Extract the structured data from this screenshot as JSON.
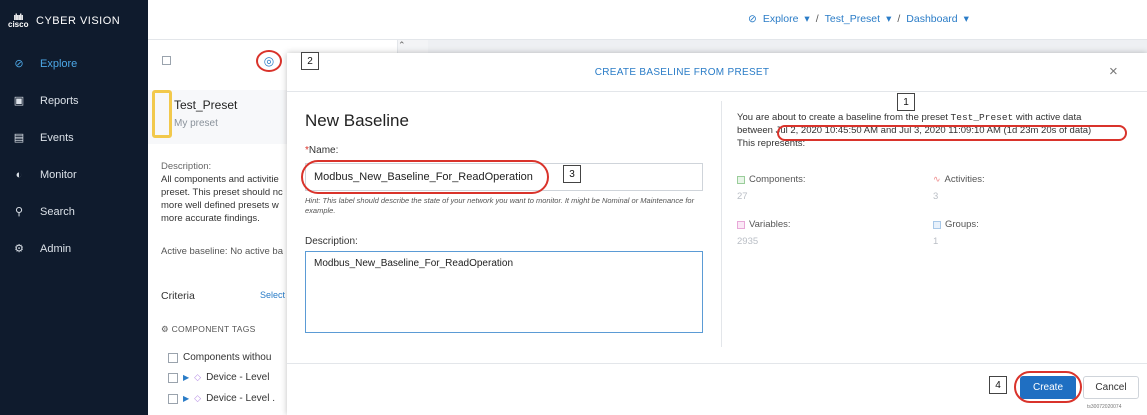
{
  "brand": {
    "logo": "cisco",
    "name": "CYBER VISION"
  },
  "nav": [
    {
      "label": "Explore",
      "icon": "compass-icon",
      "active": true
    },
    {
      "label": "Reports",
      "icon": "document-icon",
      "active": false
    },
    {
      "label": "Events",
      "icon": "calendar-icon",
      "active": false
    },
    {
      "label": "Monitor",
      "icon": "monitor-icon",
      "active": false
    },
    {
      "label": "Search",
      "icon": "search-icon",
      "active": false
    },
    {
      "label": "Admin",
      "icon": "gear-icon",
      "active": false
    }
  ],
  "breadcrumb": {
    "explore": "Explore",
    "preset": "Test_Preset",
    "view": "Dashboard"
  },
  "left_panel": {
    "preset_title": "Test_Preset",
    "preset_sub": "My preset",
    "description_label": "Description:",
    "description_lines": [
      "All components and activitie",
      "preset. This preset should nc",
      "more well defined presets w",
      "more accurate findings."
    ],
    "active_baseline_label": "Active baseline:",
    "active_baseline_value": "No active ba",
    "criteria": "Criteria",
    "select": "Select",
    "component_tags": "COMPONENT TAGS",
    "tree": [
      "Components withou",
      "Device - Level",
      "Device - Level ."
    ]
  },
  "modal": {
    "title": "CREATE BASELINE FROM PRESET",
    "heading": "New Baseline",
    "name_label": "Name:",
    "name_value": "Modbus_New_Baseline_For_ReadOperation",
    "hint": "Hint: This label should describe the state of your network you want to monitor. It might be Nominal or Maintenance for example.",
    "description_label": "Description:",
    "description_value": "Modbus_New_Baseline_For_ReadOperation",
    "info_line1_a": "You are about to create a baseline from the preset",
    "info_preset": "Test_Preset",
    "info_line1_b": "with active data",
    "info_between": "between",
    "info_dates": "Jul 2, 2020 10:45:50 AM and Jul 3, 2020 11:09:10 AM (1d 23m 20s of data)",
    "info_represents": "This represents:",
    "stats": {
      "components_label": "Components:",
      "components_value": "27",
      "activities_label": "Activities:",
      "activities_value": "3",
      "variables_label": "Variables:",
      "variables_value": "2935",
      "groups_label": "Groups:",
      "groups_value": "1"
    },
    "create": "Create",
    "cancel": "Cancel",
    "footer_id": "ts30072020074"
  },
  "callouts": {
    "c1": "1",
    "c2": "2",
    "c3": "3",
    "c4": "4"
  }
}
